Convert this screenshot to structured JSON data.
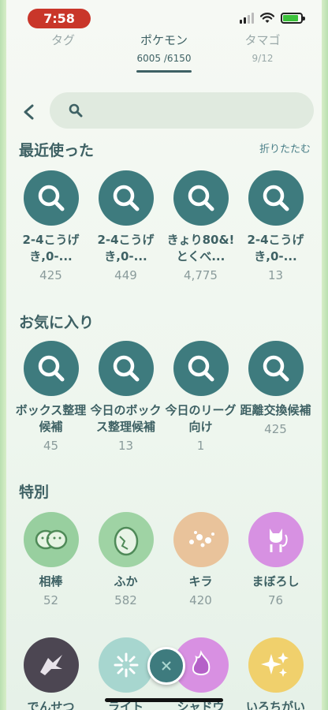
{
  "status": {
    "time": "7:58"
  },
  "tabs": [
    {
      "label": "タグ",
      "sub": ""
    },
    {
      "label": "ポケモン",
      "sub": "6005 /6150"
    },
    {
      "label": "タマゴ",
      "sub": "9/12"
    }
  ],
  "search": {
    "placeholder": ""
  },
  "recent": {
    "title": "最近使った",
    "collapse_label": "折りたたむ",
    "items": [
      {
        "label": "2-4こうげき,0-...",
        "count": "425"
      },
      {
        "label": "2-4こうげき,0-...",
        "count": "449"
      },
      {
        "label": "きょり80&!とくべ...",
        "count": "4,775"
      },
      {
        "label": "2-4こうげき,0-...",
        "count": "13"
      }
    ]
  },
  "favorites": {
    "title": "お気に入り",
    "items": [
      {
        "label": "ボックス整理候補",
        "count": "45"
      },
      {
        "label": "今日のボックス整理候補",
        "count": "13"
      },
      {
        "label": "今日のリーグ向け",
        "count": "1"
      },
      {
        "label": "距離交換候補",
        "count": "425"
      }
    ]
  },
  "special": {
    "title": "特別",
    "items": [
      {
        "label": "相棒",
        "count": "52",
        "icon": "buddy-icon"
      },
      {
        "label": "ふか",
        "count": "582",
        "icon": "egg-icon"
      },
      {
        "label": "キラ",
        "count": "420",
        "icon": "lucky-sparkle-icon"
      },
      {
        "label": "まぼろし",
        "count": "76",
        "icon": "mythical-icon"
      },
      {
        "label": "でんせつ",
        "count": "",
        "icon": "legendary-icon"
      },
      {
        "label": "ライト",
        "count": "",
        "icon": "light-icon"
      },
      {
        "label": "シャドウ",
        "count": "",
        "icon": "shadow-icon"
      },
      {
        "label": "いろちがい",
        "count": "",
        "icon": "shiny-icon"
      }
    ]
  },
  "colors": {
    "accent": "#3e7b7e",
    "title": "#3e6164",
    "time_pill": "#c9362a"
  }
}
